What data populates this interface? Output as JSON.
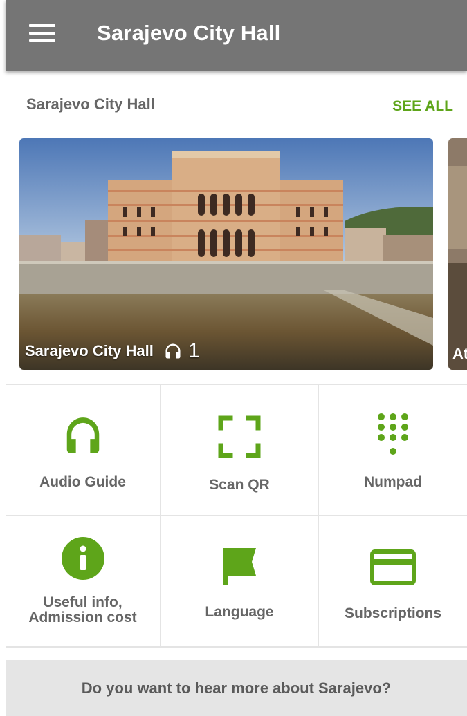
{
  "appbar": {
    "title": "Sarajevo City Hall",
    "menu_icon": "hamburger-menu-icon"
  },
  "section": {
    "title": "Sarajevo City Hall",
    "see_all": "SEE ALL"
  },
  "cards": [
    {
      "label": "Sarajevo City Hall",
      "audio_count": "1",
      "icon": "headphones-icon"
    },
    {
      "label": "At"
    }
  ],
  "grid": [
    {
      "label": "Audio Guide",
      "icon": "headphones-icon"
    },
    {
      "label": "Scan QR",
      "icon": "scan-frame-icon"
    },
    {
      "label": "Numpad",
      "icon": "numpad-icon"
    },
    {
      "label_line1": "Useful info,",
      "label_line2": "Admission cost",
      "icon": "info-icon"
    },
    {
      "label": "Language",
      "icon": "flag-icon"
    },
    {
      "label": "Subscriptions",
      "icon": "credit-card-icon"
    }
  ],
  "banner": {
    "text": "Do you want to hear more about Sarajevo?"
  },
  "colors": {
    "accent": "#5ea51a",
    "appbar": "#757575",
    "banner_bg": "#e5e5e5"
  }
}
